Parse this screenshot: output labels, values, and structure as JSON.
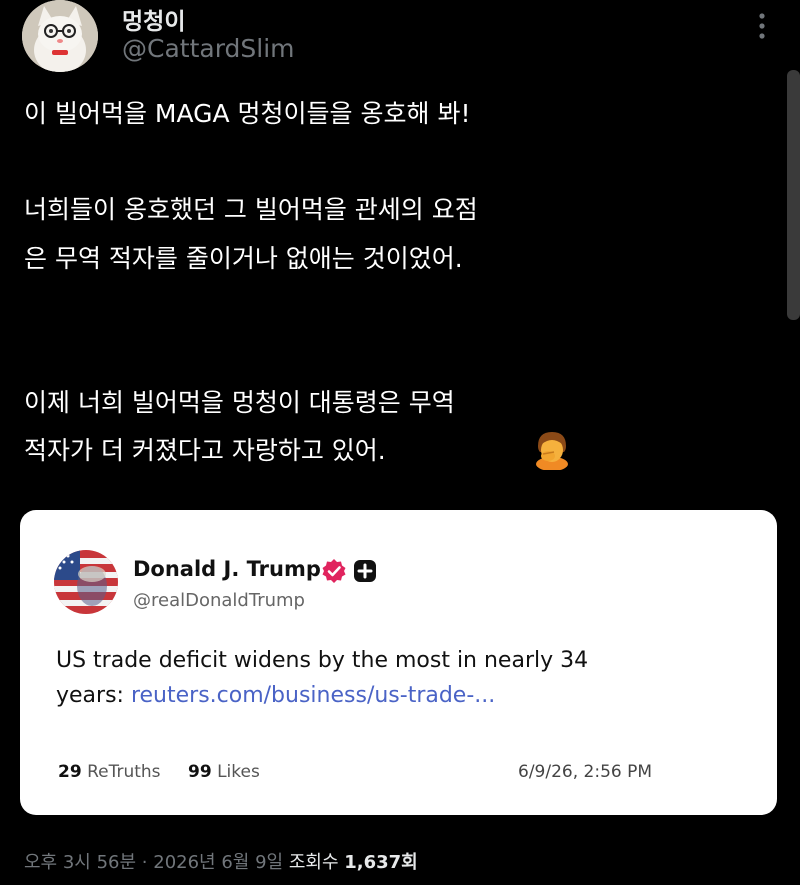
{
  "author": {
    "display_name": "멍청이",
    "handle": "@CattardSlim",
    "avatar_icon": "cat-avatar",
    "more_icon": "more-vertical-icon"
  },
  "post": {
    "lines": [
      "이 빌어먹을 MAGA 멍청이들을 옹호해 봐!",
      "너희들이 옹호했던 그 빌어먹을 관세의 요점",
      "은 무역 적자를 줄이거나 없애는 것이었어.",
      "이제 너희 빌어먹을 멍청이 대통령은 무역",
      "적자가 더 커졌다고 자랑하고 있어."
    ],
    "emoji_icon": "person-facepalming-icon"
  },
  "quote": {
    "name": "Donald J. Trump",
    "handle": "@realDonaldTrump",
    "verified_icon": "verified-badge-icon",
    "plus_icon": "plus-badge-icon",
    "text_line1": "US trade deficit widens by the most in nearly 34",
    "text_line2_prefix": "years: ",
    "link": "reuters.com/business/us-trade-...",
    "retruths_count": "29",
    "retruths_label": "ReTruths",
    "likes_count": "99",
    "likes_label": "Likes",
    "timestamp": "6/9/26, 2:56 PM"
  },
  "meta": {
    "time": "오후 3시 56분",
    "separator": "·",
    "date": "2026년 6월 9일",
    "views_label": "조회수",
    "views_count": "1,637회"
  },
  "colors": {
    "background": "#000000",
    "text": "#ffffff",
    "secondary_text": "#71767b",
    "link": "#4a63c6",
    "verified": "#e0245e"
  }
}
